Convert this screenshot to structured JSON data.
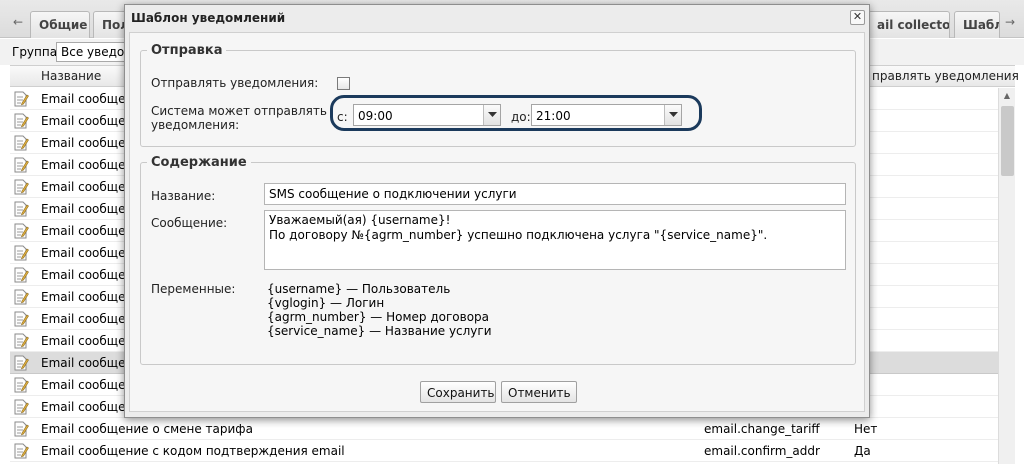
{
  "tabs": {
    "prev_arrow": "←",
    "next_arrow": "→",
    "items": [
      {
        "label": "Общие"
      },
      {
        "label": "Пол"
      },
      {
        "label": "ail collector"
      },
      {
        "label": "Шабл"
      }
    ]
  },
  "filter": {
    "label": "Группа:",
    "value": "Все уведом"
  },
  "grid": {
    "columns": {
      "name": "Название",
      "send": "правлять уведомления"
    },
    "rows": [
      {
        "name": "Email сообщение",
        "code": "",
        "flag": ""
      },
      {
        "name": "Email сообщение",
        "code": "",
        "flag": ""
      },
      {
        "name": "Email сообщение",
        "code": "",
        "flag": ""
      },
      {
        "name": "Email сообщение",
        "code": "",
        "flag": ""
      },
      {
        "name": "Email сообщение",
        "code": "",
        "flag": ""
      },
      {
        "name": "Email сообщение",
        "code": "",
        "flag": ""
      },
      {
        "name": "Email сообщение",
        "code": "",
        "flag": ""
      },
      {
        "name": "Email сообщение",
        "code": "",
        "flag": ""
      },
      {
        "name": "Email сообщение",
        "code": "",
        "flag": ""
      },
      {
        "name": "Email сообщение",
        "code": "",
        "flag": ""
      },
      {
        "name": "Email сообщение",
        "code": "",
        "flag": ""
      },
      {
        "name": "Email сообщение",
        "code": "",
        "flag": ""
      },
      {
        "name": "Email сообщение",
        "code": "",
        "flag": ""
      },
      {
        "name": "Email сообщение",
        "code": "",
        "flag": ""
      },
      {
        "name": "Email сообщение",
        "code": "",
        "flag": ""
      },
      {
        "name": "Email сообщение о смене тарифа",
        "code": "email.change_tariff",
        "flag": "Нет"
      },
      {
        "name": "Email сообщение с кодом подтверждения email",
        "code": "email.confirm_addr",
        "flag": "Да"
      }
    ],
    "selected_index": 12
  },
  "modal": {
    "title": "Шаблон уведомлений",
    "close_icon": "close-icon",
    "sending": {
      "legend": "Отправка",
      "send_label": "Отправлять уведомления:",
      "send_checked": false,
      "window_label_1": "Система может отправлять",
      "window_label_2": "уведомления:",
      "from_label": "с:",
      "from_value": "09:00",
      "to_label": "до:",
      "to_value": "21:00"
    },
    "content": {
      "legend": "Содержание",
      "name_label": "Название:",
      "name_value": "SMS сообщение о подключении услуги",
      "message_label": "Сообщение:",
      "message_lines": [
        "Уважаемый(ая) {username}!",
        "По договору №{agrm_number} успешно подключена услуга \"{service_name}\"."
      ],
      "variables_label": "Переменные:",
      "variables": [
        "{username} — Пользователь",
        "{vglogin} — Логин",
        "{agrm_number} — Номер договора",
        "{service_name} — Название услуги"
      ]
    },
    "buttons": {
      "save": "Сохранить",
      "cancel": "Отменить"
    }
  },
  "colors": {
    "highlight_ring": "#1b3a5c",
    "selected_row": "#dcdcdc"
  }
}
